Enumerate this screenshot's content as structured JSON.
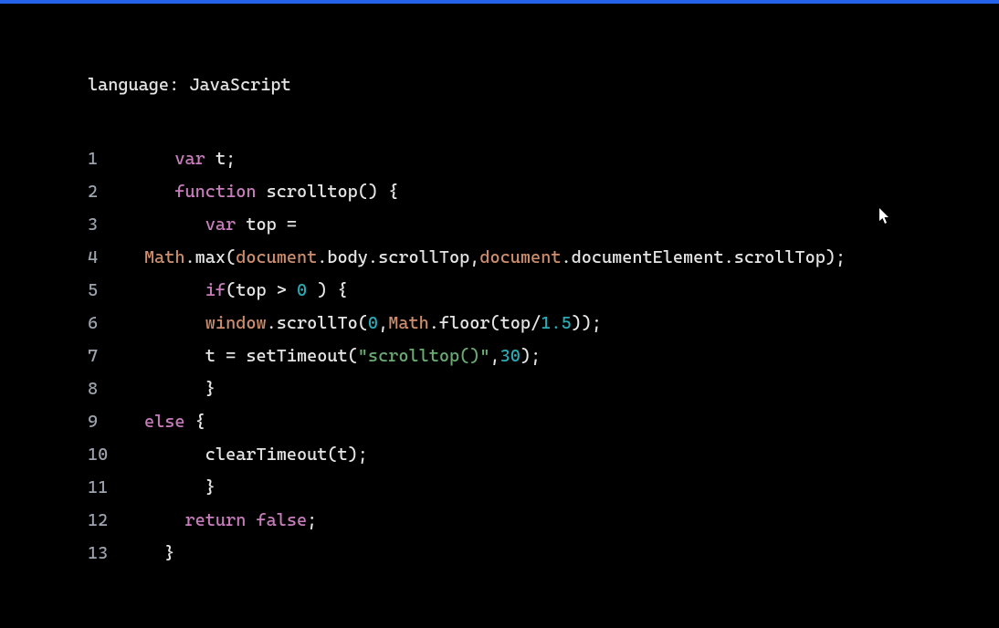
{
  "header": {
    "language_label": "language: ",
    "language_value": "JavaScript"
  },
  "code": {
    "lines": [
      {
        "num": "1",
        "tokens": [
          {
            "cls": "",
            "text": "   "
          },
          {
            "cls": "tok-keyword",
            "text": "var"
          },
          {
            "cls": "",
            "text": " t;"
          }
        ]
      },
      {
        "num": "2",
        "tokens": [
          {
            "cls": "",
            "text": "   "
          },
          {
            "cls": "tok-keyword",
            "text": "function"
          },
          {
            "cls": "",
            "text": " scrolltop() {"
          }
        ]
      },
      {
        "num": "3",
        "tokens": [
          {
            "cls": "",
            "text": "      "
          },
          {
            "cls": "tok-keyword",
            "text": "var"
          },
          {
            "cls": "",
            "text": " top ="
          }
        ]
      },
      {
        "num": "4",
        "tokens": [
          {
            "cls": "tok-builtin",
            "text": "Math"
          },
          {
            "cls": "",
            "text": ".max("
          },
          {
            "cls": "tok-builtin",
            "text": "document"
          },
          {
            "cls": "",
            "text": ".body.scrollTop,"
          },
          {
            "cls": "tok-builtin",
            "text": "document"
          },
          {
            "cls": "",
            "text": ".documentElement.scrollTop);"
          }
        ]
      },
      {
        "num": "5",
        "tokens": [
          {
            "cls": "",
            "text": "      "
          },
          {
            "cls": "tok-keyword",
            "text": "if"
          },
          {
            "cls": "",
            "text": "(top > "
          },
          {
            "cls": "tok-number",
            "text": "0"
          },
          {
            "cls": "",
            "text": " ) {"
          }
        ]
      },
      {
        "num": "6",
        "tokens": [
          {
            "cls": "",
            "text": "      "
          },
          {
            "cls": "tok-builtin",
            "text": "window"
          },
          {
            "cls": "",
            "text": ".scrollTo("
          },
          {
            "cls": "tok-number",
            "text": "0"
          },
          {
            "cls": "",
            "text": ","
          },
          {
            "cls": "tok-builtin",
            "text": "Math"
          },
          {
            "cls": "",
            "text": ".floor(top/"
          },
          {
            "cls": "tok-number",
            "text": "1.5"
          },
          {
            "cls": "",
            "text": "));"
          }
        ]
      },
      {
        "num": "7",
        "tokens": [
          {
            "cls": "",
            "text": "      t = setTimeout("
          },
          {
            "cls": "tok-string",
            "text": "\"scrolltop()\""
          },
          {
            "cls": "",
            "text": ","
          },
          {
            "cls": "tok-number",
            "text": "30"
          },
          {
            "cls": "",
            "text": ");"
          }
        ]
      },
      {
        "num": "8",
        "tokens": [
          {
            "cls": "",
            "text": "      }"
          }
        ]
      },
      {
        "num": "9",
        "tokens": [
          {
            "cls": "tok-keyword",
            "text": "else"
          },
          {
            "cls": "",
            "text": " {"
          }
        ]
      },
      {
        "num": "10",
        "tokens": [
          {
            "cls": "",
            "text": "      clearTimeout(t);"
          }
        ]
      },
      {
        "num": "11",
        "tokens": [
          {
            "cls": "",
            "text": "      }"
          }
        ]
      },
      {
        "num": "12",
        "tokens": [
          {
            "cls": "",
            "text": "    "
          },
          {
            "cls": "tok-keyword",
            "text": "return"
          },
          {
            "cls": "",
            "text": " "
          },
          {
            "cls": "tok-keyword",
            "text": "false"
          },
          {
            "cls": "",
            "text": ";"
          }
        ]
      },
      {
        "num": "13",
        "tokens": [
          {
            "cls": "",
            "text": "  }"
          }
        ]
      }
    ]
  }
}
